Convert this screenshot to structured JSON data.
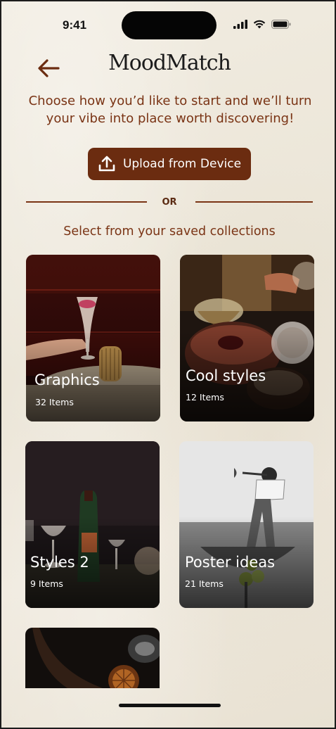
{
  "status_bar": {
    "time": "9:41"
  },
  "header": {
    "title": "MoodMatch",
    "back_icon": "arrow-left-icon"
  },
  "intro": {
    "text": "Choose how you’d like to start and we’ll turn your vibe into place worth discovering!"
  },
  "upload": {
    "label": "Upload from Device",
    "icon": "upload-icon"
  },
  "divider": {
    "label": "OR"
  },
  "collections": {
    "heading": "Select from your saved collections",
    "items": [
      {
        "title": "Graphics",
        "count": "32 Items"
      },
      {
        "title": "Cool styles",
        "count": "12 Items"
      },
      {
        "title": "Styles 2",
        "count": "9 Items"
      },
      {
        "title": "Poster ideas",
        "count": "21 Items"
      }
    ]
  },
  "colors": {
    "accent": "#6b2c10",
    "text_brown": "#7a3415",
    "background": "#efe9dd"
  }
}
